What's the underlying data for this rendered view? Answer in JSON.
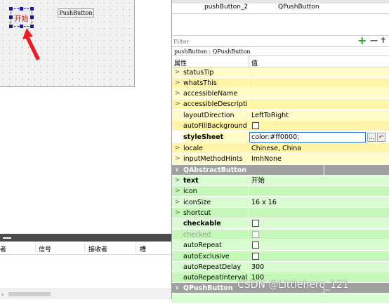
{
  "canvas": {
    "start_button_text": "开始",
    "pushbutton_text": "PushButton",
    "accent": "#ff0000"
  },
  "object_inspector": {
    "rows": [
      {
        "name": "pushButton_2",
        "class": "QPushButton"
      }
    ]
  },
  "filter": {
    "placeholder": "Filter"
  },
  "object_info": "pushButton : QPushButton",
  "property_header": {
    "property": "属性",
    "value": "值"
  },
  "properties": {
    "statusTip": {
      "label": "statusTip",
      "value": ""
    },
    "whatsThis": {
      "label": "whatsThis",
      "value": ""
    },
    "accessibleName": {
      "label": "accessibleName",
      "value": ""
    },
    "accessibleDescription": {
      "label": "accessibleDescripti...",
      "value": ""
    },
    "layoutDirection": {
      "label": "layoutDirection",
      "value": "LeftToRight"
    },
    "autoFillBackground": {
      "label": "autoFillBackground",
      "checked": false
    },
    "styleSheet": {
      "label": "styleSheet",
      "value": "color:#ff0000;"
    },
    "locale": {
      "label": "locale",
      "value": "Chinese, China"
    },
    "inputMethodHints": {
      "label": "inputMethodHints",
      "value": "ImhNone"
    },
    "section_abstract": {
      "label": "QAbstractButton"
    },
    "text": {
      "label": "text",
      "value": "开始"
    },
    "icon": {
      "label": "icon",
      "value": ""
    },
    "iconSize": {
      "label": "iconSize",
      "value": "16 x 16"
    },
    "shortcut": {
      "label": "shortcut",
      "value": ""
    },
    "checkable": {
      "label": "checkable",
      "checked": false
    },
    "checked": {
      "label": "checked",
      "checked": false
    },
    "autoRepeat": {
      "label": "autoRepeat",
      "checked": false
    },
    "autoExclusive": {
      "label": "autoExclusive",
      "checked": false
    },
    "autoRepeatDelay": {
      "label": "autoRepeatDelay",
      "value": "300"
    },
    "autoRepeatInterval": {
      "label": "autoRepeatInterval",
      "value": "100"
    },
    "section_pushbutton": {
      "label": "QPushButton"
    }
  },
  "signal_slot": {
    "col_sender": "者",
    "col_signal": "信号",
    "col_receiver": "接收者",
    "col_slot": "槽"
  },
  "watermark": "CSDN @Littlehero_121",
  "colors": {
    "yellow_row": "#fffbc8",
    "green_row": "#d8fbd0",
    "section": "#a0a0a0",
    "selection_border": "#1e6fd9"
  }
}
